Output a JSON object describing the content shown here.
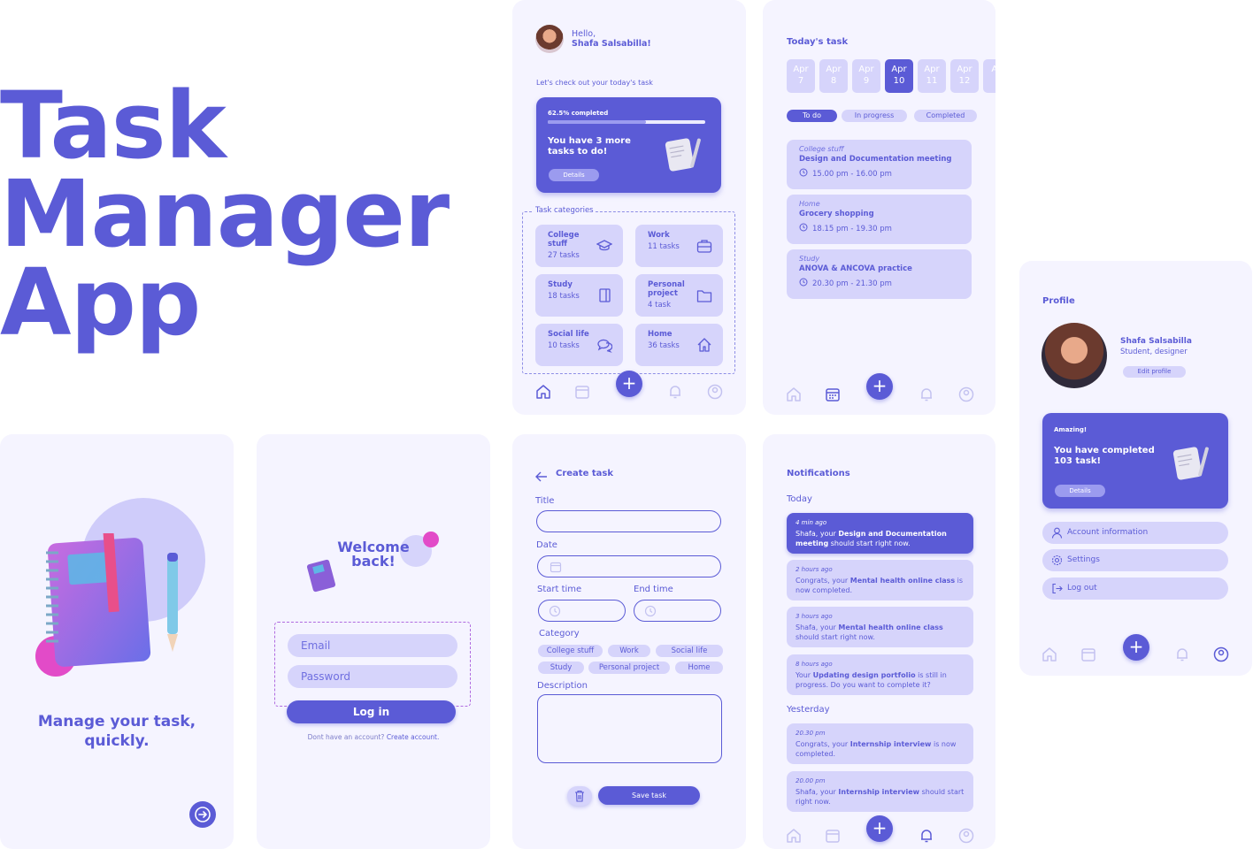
{
  "hero": {
    "line1": "Task",
    "line2": "Manager",
    "line3": "App"
  },
  "colors": {
    "primary": "#5B5BD6",
    "lavender": "#D6D4FB",
    "background": "#F5F4FF",
    "accent_pink": "#E24BC8"
  },
  "splash": {
    "tagline_line1": "Manage your task,",
    "tagline_line2": "quickly.",
    "next_icon": "arrow-right-icon"
  },
  "login": {
    "welcome_line1": "Welcome",
    "welcome_line2": "back!",
    "email_placeholder": "Email",
    "password_placeholder": "Password",
    "login_label": "Log in",
    "no_account_text": "Dont have an account?",
    "create_account_link": "Create account."
  },
  "home": {
    "greeting": "Hello,",
    "user_name": "Shafa Salsabilla!",
    "subtitle": "Let's check out your today's task",
    "progress_label": "62.5% completed",
    "progress_fraction": 0.625,
    "progress_text_line1": "You have 3 more",
    "progress_text_line2": "tasks to do!",
    "details_label": "Details",
    "categories_heading": "Task categories",
    "categories": [
      {
        "name": "College stuff",
        "count": "27 tasks",
        "icon": "graduation-cap-icon"
      },
      {
        "name": "Work",
        "count": "11 tasks",
        "icon": "briefcase-icon"
      },
      {
        "name": "Study",
        "count": "18 tasks",
        "icon": "book-icon"
      },
      {
        "name": "Personal project",
        "count": "4 task",
        "icon": "folder-icon"
      },
      {
        "name": "Social life",
        "count": "10 tasks",
        "icon": "chat-icon"
      },
      {
        "name": "Home",
        "count": "36 tasks",
        "icon": "house-icon"
      }
    ]
  },
  "today": {
    "heading": "Today's task",
    "dates": [
      {
        "month": "Apr",
        "day": "7"
      },
      {
        "month": "Apr",
        "day": "8"
      },
      {
        "month": "Apr",
        "day": "9"
      },
      {
        "month": "Apr",
        "day": "10"
      },
      {
        "month": "Apr",
        "day": "11"
      },
      {
        "month": "Apr",
        "day": "12"
      },
      {
        "month": "Ap",
        "day": "1"
      }
    ],
    "filters": [
      "To do",
      "In progress",
      "Completed"
    ],
    "tasks": [
      {
        "category": "College stuff",
        "name": "Design and Documentation meeting",
        "time": "15.00 pm - 16.00 pm"
      },
      {
        "category": "Home",
        "name": "Grocery shopping",
        "time": "18.15 pm - 19.30 pm"
      },
      {
        "category": "Study",
        "name": "ANOVA & ANCOVA practice",
        "time": "20.30 pm - 21.30 pm"
      }
    ]
  },
  "create": {
    "heading": "Create task",
    "title_label": "Title",
    "date_label": "Date",
    "start_label": "Start time",
    "end_label": "End time",
    "category_label": "Category",
    "categories_row1": [
      "College stuff",
      "Work",
      "Social life"
    ],
    "categories_row2": [
      "Study",
      "Personal project",
      "Home"
    ],
    "description_label": "Description",
    "save_label": "Save task"
  },
  "notifications": {
    "heading": "Notifications",
    "today_label": "Today",
    "yesterday_label": "Yesterday",
    "today_items": [
      {
        "time": "4 min ago",
        "pre": "Shafa, your ",
        "bold": "Design and Documentation meeting",
        "post": " should start right now."
      },
      {
        "time": "2 hours ago",
        "pre": "Congrats, your ",
        "bold": "Mental health online class",
        "post": " is now completed."
      },
      {
        "time": "3 hours ago",
        "pre": "Shafa, your ",
        "bold": "Mental health online class",
        "post": " should start right now."
      },
      {
        "time": "8 hours ago",
        "pre": "Your ",
        "bold": "Updating design portfolio",
        "post": " is still in progress. Do you want to complete it?"
      }
    ],
    "yesterday_items": [
      {
        "time": "20.30 pm",
        "pre": "Congrats, your ",
        "bold": "Internship interview",
        "post": " is now completed."
      },
      {
        "time": "20.00 pm",
        "pre": "Shafa, your ",
        "bold": "Internship interview",
        "post": " should start right now."
      }
    ]
  },
  "profile": {
    "heading": "Profile",
    "name": "Shafa Salsabilla",
    "role": "Student, designer",
    "edit_label": "Edit profile",
    "card_kicker": "Amazing!",
    "card_line1": "You have completed",
    "card_line2": "103 task!",
    "details_label": "Details",
    "account_label": "Account information",
    "settings_label": "Settings",
    "logout_label": "Log out"
  }
}
